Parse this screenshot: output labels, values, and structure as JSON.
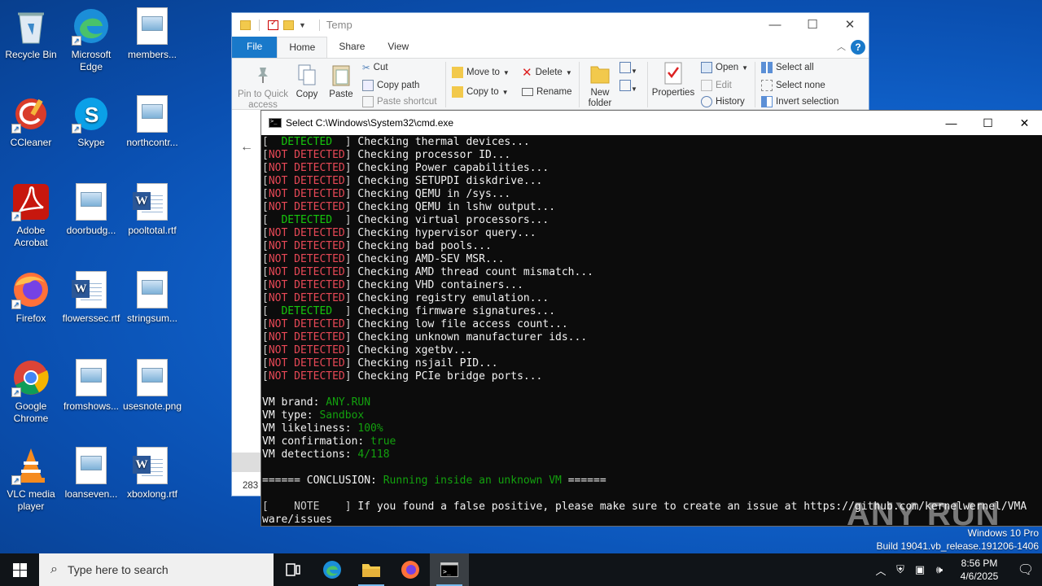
{
  "desktop": {
    "icons": [
      {
        "label": "Recycle Bin",
        "icon": "recycle-bin-icon"
      },
      {
        "label": "Microsoft Edge",
        "icon": "edge-icon"
      },
      {
        "label": "members...",
        "icon": "image-file-icon"
      },
      {
        "label": "CCleaner",
        "icon": "ccleaner-icon"
      },
      {
        "label": "Skype",
        "icon": "skype-icon"
      },
      {
        "label": "northcontr...",
        "icon": "image-file-icon"
      },
      {
        "label": "Adobe Acrobat",
        "icon": "acrobat-icon"
      },
      {
        "label": "doorbudg...",
        "icon": "image-file-icon"
      },
      {
        "label": "pooltotal.rtf",
        "icon": "word-file-icon"
      },
      {
        "label": "Firefox",
        "icon": "firefox-icon"
      },
      {
        "label": "flowerssec.rtf",
        "icon": "word-file-icon"
      },
      {
        "label": "stringsum...",
        "icon": "image-file-icon"
      },
      {
        "label": "Google Chrome",
        "icon": "chrome-icon"
      },
      {
        "label": "fromshows...",
        "icon": "image-file-icon"
      },
      {
        "label": "usesnote.png",
        "icon": "image-file-icon"
      },
      {
        "label": "VLC media player",
        "icon": "vlc-icon"
      },
      {
        "label": "loanseven...",
        "icon": "image-file-icon"
      },
      {
        "label": "xboxlong.rtf",
        "icon": "word-file-icon"
      }
    ]
  },
  "explorer": {
    "title": "Temp",
    "tabs": {
      "file": "File",
      "home": "Home",
      "share": "Share",
      "view": "View"
    },
    "ribbon": {
      "pin": "Pin to Quick access",
      "copy": "Copy",
      "paste": "Paste",
      "cut": "Cut",
      "copy_path": "Copy path",
      "paste_shortcut": "Paste shortcut",
      "move_to": "Move to",
      "copy_to": "Copy to",
      "delete": "Delete",
      "rename": "Rename",
      "new_folder": "New folder",
      "properties": "Properties",
      "open": "Open",
      "edit": "Edit",
      "history": "History",
      "select_all": "Select all",
      "select_none": "Select none",
      "invert_selection": "Invert selection"
    },
    "status_count": "283"
  },
  "cmd": {
    "title": "Select C:\\Windows\\System32\\cmd.exe",
    "checks": [
      {
        "status": "  DETECTED  ",
        "detected": true,
        "text": "Checking thermal devices..."
      },
      {
        "status": "NOT DETECTED",
        "detected": false,
        "text": "Checking processor ID..."
      },
      {
        "status": "NOT DETECTED",
        "detected": false,
        "text": "Checking Power capabilities..."
      },
      {
        "status": "NOT DETECTED",
        "detected": false,
        "text": "Checking SETUPDI diskdrive..."
      },
      {
        "status": "NOT DETECTED",
        "detected": false,
        "text": "Checking QEMU in /sys..."
      },
      {
        "status": "NOT DETECTED",
        "detected": false,
        "text": "Checking QEMU in lshw output..."
      },
      {
        "status": "  DETECTED  ",
        "detected": true,
        "text": "Checking virtual processors..."
      },
      {
        "status": "NOT DETECTED",
        "detected": false,
        "text": "Checking hypervisor query..."
      },
      {
        "status": "NOT DETECTED",
        "detected": false,
        "text": "Checking bad pools..."
      },
      {
        "status": "NOT DETECTED",
        "detected": false,
        "text": "Checking AMD-SEV MSR..."
      },
      {
        "status": "NOT DETECTED",
        "detected": false,
        "text": "Checking AMD thread count mismatch..."
      },
      {
        "status": "NOT DETECTED",
        "detected": false,
        "text": "Checking VHD containers..."
      },
      {
        "status": "NOT DETECTED",
        "detected": false,
        "text": "Checking registry emulation..."
      },
      {
        "status": "  DETECTED  ",
        "detected": true,
        "text": "Checking firmware signatures..."
      },
      {
        "status": "NOT DETECTED",
        "detected": false,
        "text": "Checking low file access count..."
      },
      {
        "status": "NOT DETECTED",
        "detected": false,
        "text": "Checking unknown manufacturer ids..."
      },
      {
        "status": "NOT DETECTED",
        "detected": false,
        "text": "Checking xgetbv..."
      },
      {
        "status": "NOT DETECTED",
        "detected": false,
        "text": "Checking nsjail PID..."
      },
      {
        "status": "NOT DETECTED",
        "detected": false,
        "text": "Checking PCIe bridge ports..."
      }
    ],
    "summary": [
      {
        "key": "VM brand: ",
        "value": "ANY.RUN"
      },
      {
        "key": "VM type: ",
        "value": "Sandbox"
      },
      {
        "key": "VM likeliness: ",
        "value": "100%"
      },
      {
        "key": "VM confirmation: ",
        "value": "true"
      },
      {
        "key": "VM detections: ",
        "value": "4/118"
      }
    ],
    "conclusion_prefix": "====== CONCLUSION: ",
    "conclusion_text": "Running inside an unknown VM",
    "conclusion_suffix": " ======",
    "note_tag": "[    NOTE    ]",
    "note_text": " If you found a false positive, please make sure to create an issue at https://github.com/kernelwernel/VMA",
    "note_wrap": "ware/issues"
  },
  "watermark": "ANY RUN",
  "windows_version": {
    "edition": "Windows 10 Pro",
    "build": "Build 19041.vb_release.191206-1406"
  },
  "taskbar": {
    "search_placeholder": "Type here to search",
    "time": "8:56 PM",
    "date": "4/6/2025"
  },
  "colors": {
    "detected": "#16c60c",
    "not_detected": "#e74856",
    "accent": "#1979ca"
  }
}
